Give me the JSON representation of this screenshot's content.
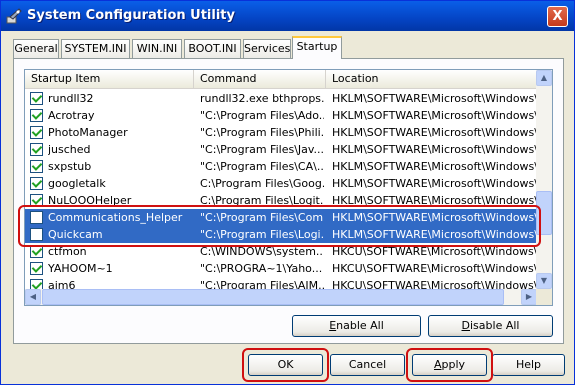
{
  "window": {
    "title": "System Configuration Utility",
    "close_label": "X"
  },
  "tabs": [
    {
      "label": "General"
    },
    {
      "label": "SYSTEM.INI"
    },
    {
      "label": "WIN.INI"
    },
    {
      "label": "BOOT.INI"
    },
    {
      "label": "Services"
    },
    {
      "label": "Startup"
    }
  ],
  "active_tab": "Startup",
  "list": {
    "columns": [
      "Startup Item",
      "Command",
      "Location"
    ],
    "rows": [
      {
        "item": "rundll32",
        "command": "rundll32.exe bthprops...",
        "location": "HKLM\\SOFTWARE\\Microsoft\\Windows\\Curr",
        "checked": true,
        "selected": false
      },
      {
        "item": "Acrotray",
        "command": "\"C:\\Program Files\\Ado...",
        "location": "HKLM\\SOFTWARE\\Microsoft\\Windows\\Curr",
        "checked": true,
        "selected": false
      },
      {
        "item": "PhotoManager",
        "command": "\"C:\\Program Files\\Phili...",
        "location": "HKLM\\SOFTWARE\\Microsoft\\Windows\\Curr",
        "checked": true,
        "selected": false
      },
      {
        "item": "jusched",
        "command": "\"C:\\Program Files\\Jav...",
        "location": "HKLM\\SOFTWARE\\Microsoft\\Windows\\Curr",
        "checked": true,
        "selected": false
      },
      {
        "item": "sxpstub",
        "command": "\"C:\\Program Files\\CA\\...",
        "location": "HKLM\\SOFTWARE\\Microsoft\\Windows\\Curr",
        "checked": true,
        "selected": false
      },
      {
        "item": "googletalk",
        "command": "C:\\Program Files\\Goog...",
        "location": "HKLM\\SOFTWARE\\Microsoft\\Windows\\Curr",
        "checked": true,
        "selected": false
      },
      {
        "item": "NuLOOOHelper",
        "command": "C:\\Program Files\\Logit...",
        "location": "HKLM\\SOFTWARE\\Microsoft\\Windows\\Curr",
        "checked": true,
        "selected": false
      },
      {
        "item": "Communications_Helper",
        "command": "\"C:\\Program Files\\Com...",
        "location": "HKLM\\SOFTWARE\\Microsoft\\Windows\\Curr",
        "checked": false,
        "selected": true
      },
      {
        "item": "Quickcam",
        "command": "\"C:\\Program Files\\Logi...",
        "location": "HKLM\\SOFTWARE\\Microsoft\\Windows\\Curr",
        "checked": false,
        "selected": true
      },
      {
        "item": "ctfmon",
        "command": "C:\\WINDOWS\\system...",
        "location": "HKCU\\SOFTWARE\\Microsoft\\Windows\\Curr",
        "checked": true,
        "selected": false
      },
      {
        "item": "YAHOOM~1",
        "command": "\"C:\\PROGRA~1\\Yaho...",
        "location": "HKCU\\SOFTWARE\\Microsoft\\Windows\\Curr",
        "checked": true,
        "selected": false
      },
      {
        "item": "aim6",
        "command": "\"C:\\Program Files\\AIM...",
        "location": "HKCU\\SOFTWARE\\Microsoft\\Windows\\Curr",
        "checked": true,
        "selected": false
      }
    ]
  },
  "buttons": {
    "enable_all": {
      "pre": "",
      "u": "E",
      "post": "nable All"
    },
    "disable_all": {
      "pre": "",
      "u": "D",
      "post": "isable All"
    },
    "ok": "OK",
    "cancel": "Cancel",
    "apply": {
      "pre": "",
      "u": "A",
      "post": "pply"
    },
    "help": "Help"
  },
  "colors": {
    "highlight": "#d01010",
    "selection": "#316ac5",
    "titlebar": "#0444c4"
  }
}
